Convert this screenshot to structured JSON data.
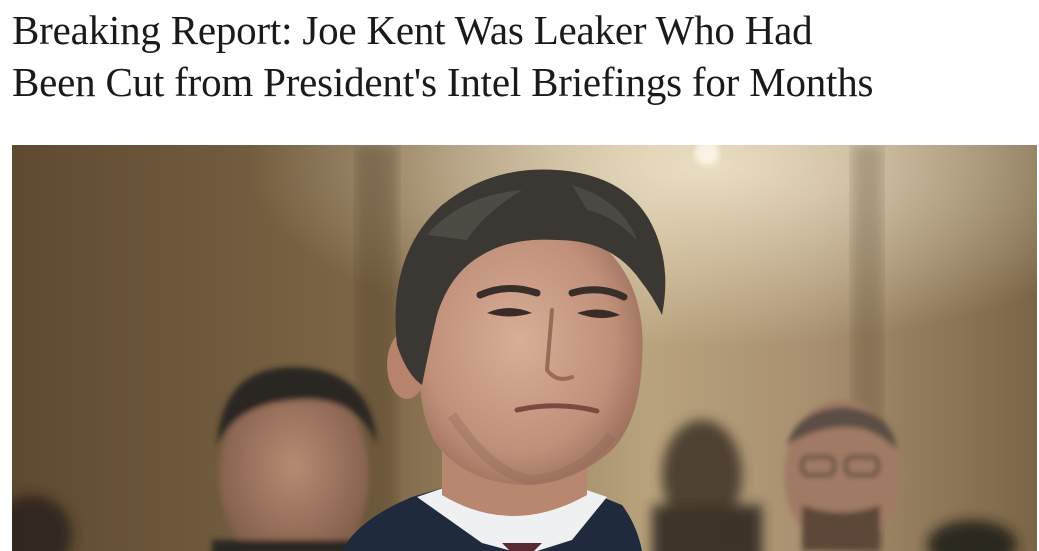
{
  "article": {
    "headline_line1": "Breaking Report: Joe Kent Was Leaker Who Had",
    "headline_line2": "Been Cut from President's Intel Briefings for Months"
  },
  "photo": {
    "subject": "man in dark suit at hearing with people seated behind him",
    "colors": {
      "wall": "#8a7452",
      "wall_light": "#c9b48d",
      "hair": "#3b3834",
      "skin": "#c99c84",
      "suit": "#1f2a3d"
    }
  }
}
